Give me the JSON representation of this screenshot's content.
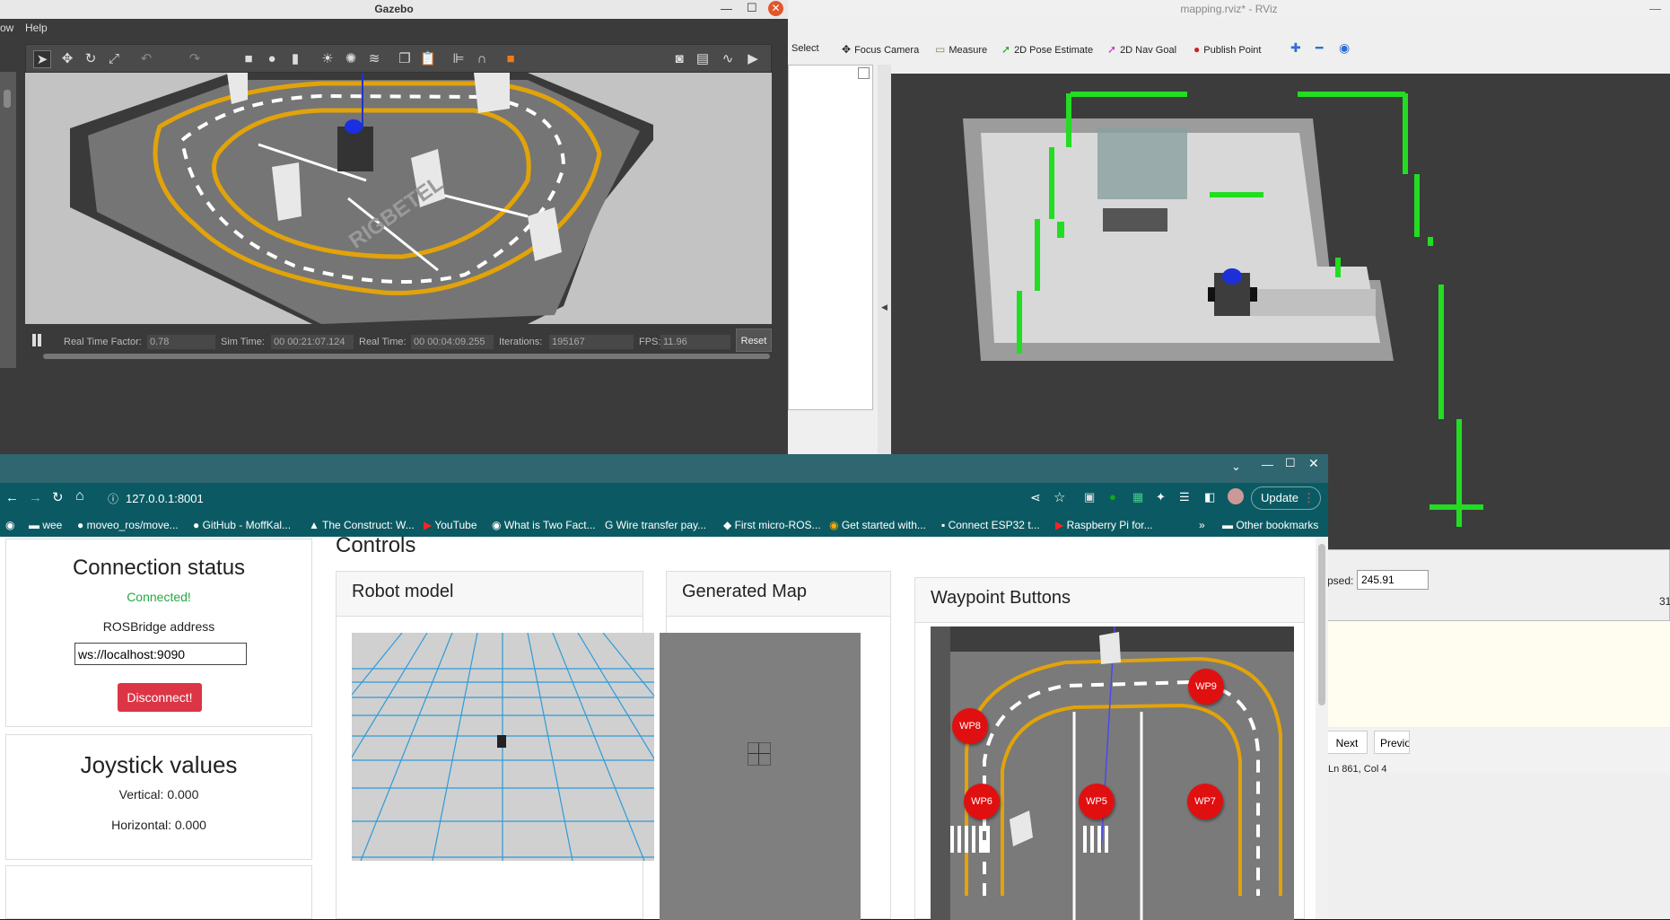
{
  "gazebo": {
    "title": "Gazebo",
    "menu": [
      "ow",
      "Help"
    ],
    "status": {
      "rtf_label": "Real Time Factor:",
      "rtf_value": "0.78",
      "sim_label": "Sim Time:",
      "sim_value": "00 00:21:07.124",
      "real_label": "Real Time:",
      "real_value": "00 00:04:09.255",
      "iter_label": "Iterations:",
      "iter_value": "195167",
      "fps_label": "FPS:",
      "fps_value": "11.96",
      "reset_label": "Reset"
    },
    "scene_text": "RIGBETEL"
  },
  "rviz": {
    "title": "mapping.rviz* - RViz",
    "tools": [
      "Select",
      "Focus Camera",
      "Measure",
      "2D Pose Estimate",
      "2D Nav Goal",
      "Publish Point"
    ],
    "elapsed_label": "psed:",
    "elapsed_value": "245.91",
    "side_value": "31",
    "next_label": "Next",
    "prev_label": "Previo",
    "status": "Ln 861, Col 4"
  },
  "chrome": {
    "url": "127.0.0.1:8001",
    "update_label": "Update",
    "bookmarks": [
      "wee",
      "moveo_ros/move...",
      "GitHub - MoffKal...",
      "The Construct: W...",
      "YouTube",
      "What is Two Fact...",
      "Wire transfer pay...",
      "First micro-ROS...",
      "Get started with...",
      "Connect ESP32 t...",
      "Raspberry Pi for..."
    ],
    "other_bookmarks": "Other bookmarks"
  },
  "page": {
    "connection_title": "Connection status",
    "connection_state": "Connected!",
    "rosbridge_label": "ROSBridge address",
    "rosbridge_value": "ws://localhost:9090",
    "disconnect_label": "Disconnect!",
    "joystick_title": "Joystick values",
    "vertical": "Vertical: 0.000",
    "horizontal": "Horizontal: 0.000",
    "controls_title": "Controls",
    "robot_model_title": "Robot model",
    "map_title": "Generated Map",
    "waypoints_title": "Waypoint Buttons",
    "waypoints": [
      "WP9",
      "WP8",
      "WP6",
      "WP5",
      "WP7"
    ]
  },
  "colors": {
    "connected": "#28a745",
    "disconnect": "#dc3545",
    "waypoint": "#e01010",
    "chrome_teal": "#0b5a63"
  }
}
